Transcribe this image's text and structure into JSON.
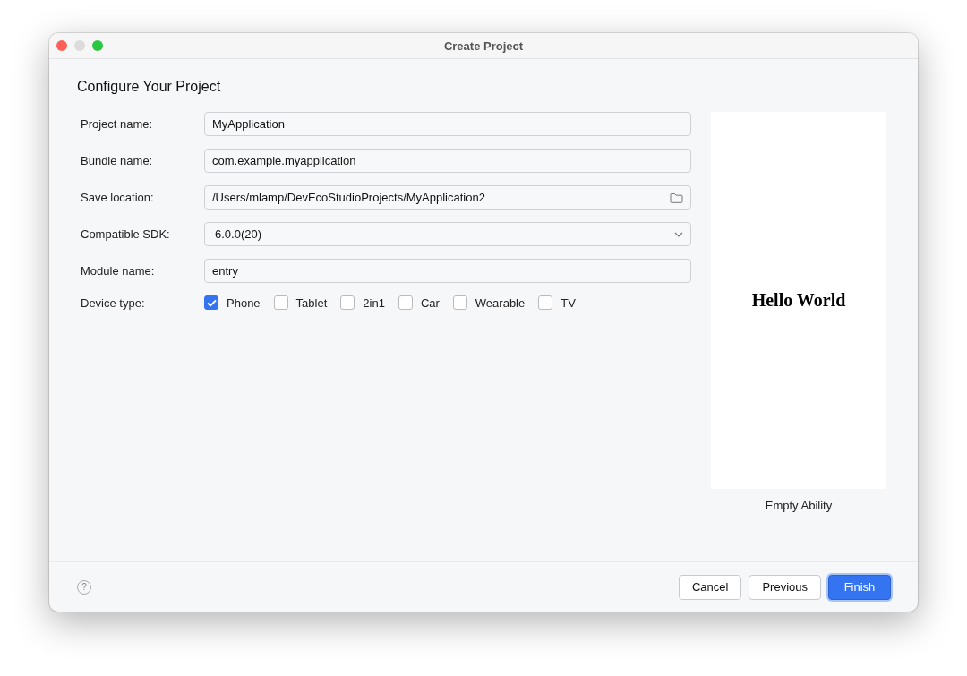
{
  "window": {
    "title": "Create Project"
  },
  "heading": "Configure Your Project",
  "fields": [
    {
      "label": "Project name:",
      "kind": "text",
      "value": "MyApplication"
    },
    {
      "label": "Bundle name:",
      "kind": "text",
      "value": "com.example.myapplication"
    },
    {
      "label": "Save location:",
      "kind": "folder",
      "value": "/Users/mlamp/DevEcoStudioProjects/MyApplication2"
    },
    {
      "label": "Compatible SDK:",
      "kind": "dropdown",
      "value": "6.0.0(20)"
    },
    {
      "label": "Module name:",
      "kind": "text",
      "value": "entry"
    }
  ],
  "device_type": {
    "label": "Device type:",
    "options": [
      {
        "label": "Phone",
        "checked": true
      },
      {
        "label": "Tablet",
        "checked": false
      },
      {
        "label": "2in1",
        "checked": false
      },
      {
        "label": "Car",
        "checked": false
      },
      {
        "label": "Wearable",
        "checked": false
      },
      {
        "label": "TV",
        "checked": false
      }
    ]
  },
  "preview": {
    "text": "Hello World",
    "caption": "Empty Ability"
  },
  "footer": {
    "help": "?",
    "buttons": [
      {
        "label": "Cancel",
        "kind": "default"
      },
      {
        "label": "Previous",
        "kind": "default"
      },
      {
        "label": "Finish",
        "kind": "primary"
      }
    ]
  }
}
